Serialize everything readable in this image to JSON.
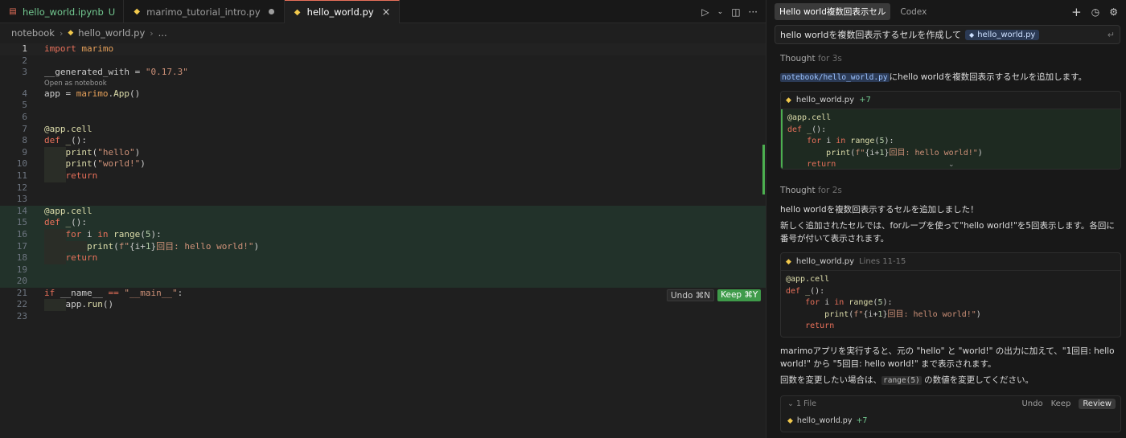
{
  "tabs": [
    {
      "label": "hello_world.ipynb",
      "status": "U"
    },
    {
      "label": "marimo_tutorial_intro.py"
    },
    {
      "label": "hello_world.py"
    }
  ],
  "tab_actions": {
    "run": "▷",
    "run_more": "⌄",
    "split": "◫",
    "more": "···"
  },
  "breadcrumb": {
    "folder": "notebook",
    "file": "hello_world.py",
    "more": "..."
  },
  "code": {
    "lines": [
      {
        "n": "1",
        "parts": [
          [
            "kw",
            "import "
          ],
          [
            "mod",
            "marimo"
          ]
        ]
      },
      {
        "n": "2",
        "parts": []
      },
      {
        "n": "3",
        "parts": [
          [
            "var",
            "__generated_with = "
          ],
          [
            "str",
            "\"0.17.3\""
          ]
        ]
      },
      {
        "n": "4",
        "parts": [
          [
            "var",
            "app = "
          ],
          [
            "mod",
            "marimo"
          ],
          [
            "var",
            "."
          ],
          [
            "fn",
            "App"
          ],
          [
            "var",
            "()"
          ]
        ]
      },
      {
        "n": "5",
        "parts": []
      },
      {
        "n": "6",
        "parts": []
      },
      {
        "n": "7",
        "parts": [
          [
            "fn",
            "@app.cell"
          ]
        ]
      },
      {
        "n": "8",
        "parts": [
          [
            "kw",
            "def "
          ],
          [
            "fn",
            "_"
          ],
          [
            "var",
            "():"
          ]
        ]
      },
      {
        "n": "9",
        "indent": 1,
        "parts": [
          [
            "fn",
            "print"
          ],
          [
            "var",
            "("
          ],
          [
            "str",
            "\"hello\""
          ],
          [
            "var",
            ")"
          ]
        ]
      },
      {
        "n": "10",
        "indent": 1,
        "parts": [
          [
            "fn",
            "print"
          ],
          [
            "var",
            "("
          ],
          [
            "str",
            "\"world!\""
          ],
          [
            "var",
            ")"
          ]
        ]
      },
      {
        "n": "11",
        "indent": 1,
        "parts": [
          [
            "kw",
            "return"
          ]
        ]
      },
      {
        "n": "12",
        "parts": []
      },
      {
        "n": "13",
        "parts": []
      },
      {
        "n": "14",
        "added": true,
        "parts": [
          [
            "fn",
            "@app.cell"
          ]
        ]
      },
      {
        "n": "15",
        "added": true,
        "parts": [
          [
            "kw",
            "def "
          ],
          [
            "fn",
            "_"
          ],
          [
            "var",
            "():"
          ]
        ]
      },
      {
        "n": "16",
        "added": true,
        "indent": 1,
        "parts": [
          [
            "kw",
            "for "
          ],
          [
            "var",
            "i "
          ],
          [
            "kw",
            "in "
          ],
          [
            "fn",
            "range"
          ],
          [
            "var",
            "("
          ],
          [
            "num",
            "5"
          ],
          [
            "var",
            "):"
          ]
        ]
      },
      {
        "n": "17",
        "added": true,
        "indent": 2,
        "parts": [
          [
            "fn",
            "print"
          ],
          [
            "var",
            "("
          ],
          [
            "str",
            "f\""
          ],
          [
            "var",
            "{i+"
          ],
          [
            "num",
            "1"
          ],
          [
            "var",
            "}"
          ],
          [
            "str",
            "回目: hello world!\""
          ],
          [
            "var",
            ")"
          ]
        ]
      },
      {
        "n": "18",
        "added": true,
        "indent": 1,
        "parts": [
          [
            "kw",
            "return"
          ]
        ]
      },
      {
        "n": "19",
        "added": true,
        "parts": []
      },
      {
        "n": "20",
        "added": true,
        "parts": []
      },
      {
        "n": "21",
        "parts": [
          [
            "kw",
            "if "
          ],
          [
            "var",
            "__name__ "
          ],
          [
            "kw",
            "== "
          ],
          [
            "str",
            "\"__main__\""
          ],
          [
            "var",
            ":"
          ]
        ]
      },
      {
        "n": "22",
        "indent": 1,
        "parts": [
          [
            "var",
            "app."
          ],
          [
            "fn",
            "run"
          ],
          [
            "var",
            "()"
          ]
        ]
      },
      {
        "n": "23",
        "parts": []
      }
    ],
    "codelens": "Open as notebook"
  },
  "diff_actions": {
    "undo": "Undo ⌘N",
    "keep": "Keep ⌘Y"
  },
  "chat": {
    "tabs": [
      "Hello world複数回表示セル",
      "Codex"
    ],
    "head_actions": {
      "new": "+",
      "history": "◷",
      "settings": "⚙"
    },
    "prompt": {
      "text": "hello worldを複数回表示するセルを作成して",
      "chip": "hello_world.py",
      "return": "↵"
    },
    "thought1": {
      "label": "Thought",
      "dur": "for 3s"
    },
    "msg1": {
      "code": "notebook/hello_world.py",
      "text": "にhello worldを複数回表示するセルを追加します。"
    },
    "card1": {
      "file": "hello_world.py",
      "delta": "+7",
      "lines": [
        [
          [
            "fn",
            "@app.cell"
          ]
        ],
        [
          [
            "kw",
            "def "
          ],
          [
            "fn",
            "_"
          ],
          [
            "var",
            "():"
          ]
        ],
        [
          [
            "var",
            "    "
          ],
          [
            "kw",
            "for "
          ],
          [
            "var",
            "i "
          ],
          [
            "kw",
            "in "
          ],
          [
            "fn",
            "range"
          ],
          [
            "var",
            "("
          ],
          [
            "num",
            "5"
          ],
          [
            "var",
            "):"
          ]
        ],
        [
          [
            "var",
            "        "
          ],
          [
            "fn",
            "print"
          ],
          [
            "var",
            "("
          ],
          [
            "str",
            "f\""
          ],
          [
            "var",
            "{i+"
          ],
          [
            "num",
            "1"
          ],
          [
            "var",
            "}"
          ],
          [
            "str",
            "回目: hello world!\""
          ],
          [
            "var",
            ")"
          ]
        ],
        [
          [
            "var",
            "    "
          ],
          [
            "kw",
            "return"
          ]
        ]
      ],
      "expand": "⌄"
    },
    "thought2": {
      "label": "Thought",
      "dur": "for 2s"
    },
    "msg2": "hello worldを複数回表示するセルを追加しました！",
    "msg3": "新しく追加されたセルでは、forループを使って\"hello world!\"を5回表示します。各回に番号が付いて表示されます。",
    "card2": {
      "file": "hello_world.py",
      "lines_label": "Lines 11-15",
      "lines": [
        [
          [
            "fn",
            "@app.cell"
          ]
        ],
        [
          [
            "kw",
            "def "
          ],
          [
            "fn",
            "_"
          ],
          [
            "var",
            "():"
          ]
        ],
        [
          [
            "var",
            "    "
          ],
          [
            "kw",
            "for "
          ],
          [
            "var",
            "i "
          ],
          [
            "kw",
            "in "
          ],
          [
            "fn",
            "range"
          ],
          [
            "var",
            "("
          ],
          [
            "num",
            "5"
          ],
          [
            "var",
            "):"
          ]
        ],
        [
          [
            "var",
            "        "
          ],
          [
            "fn",
            "print"
          ],
          [
            "var",
            "("
          ],
          [
            "str",
            "f\""
          ],
          [
            "var",
            "{i+"
          ],
          [
            "num",
            "1"
          ],
          [
            "var",
            "}"
          ],
          [
            "str",
            "回目: hello world!\""
          ],
          [
            "var",
            ")"
          ]
        ],
        [
          [
            "var",
            "    "
          ],
          [
            "kw",
            "return"
          ]
        ]
      ]
    },
    "msg4": "marimoアプリを実行すると、元の \"hello\" と \"world!\" の出力に加えて、\"1回目: hello world!\" から \"5回目: hello world!\" まで表示されます。",
    "msg5": {
      "before": "回数を変更したい場合は、",
      "code": "range(5)",
      "after": " の数値を変更してください。"
    },
    "files": {
      "count": "1 File",
      "chevron": "⌄",
      "undo": "Undo",
      "keep": "Keep",
      "review": "Review",
      "file": "hello_world.py",
      "delta": "+7"
    }
  },
  "colors": {
    "accent_tab": "#e8705a",
    "added_bg": "#22322a",
    "keep_green": "#3f9b4a",
    "chip_blue": "#2b3a55"
  }
}
